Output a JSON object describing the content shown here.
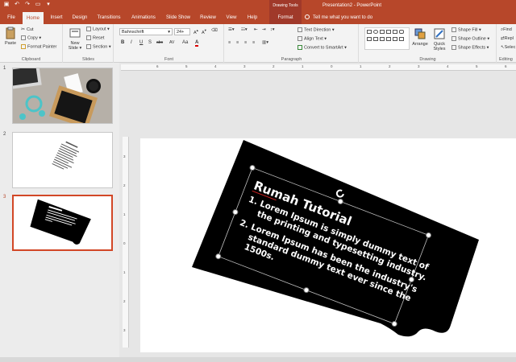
{
  "window": {
    "title": "Presentation2 - PowerPoint",
    "contextual_label": "Drawing Tools"
  },
  "tabs": [
    "File",
    "Home",
    "Insert",
    "Design",
    "Transitions",
    "Animations",
    "Slide Show",
    "Review",
    "View",
    "Help",
    "Format"
  ],
  "active_tab": "Home",
  "tell_me": "Tell me what you want to do",
  "ribbon": {
    "clipboard": {
      "label": "Clipboard",
      "paste": "Paste",
      "cut": "Cut",
      "copy": "Copy",
      "format_painter": "Format Painter"
    },
    "slides": {
      "label": "Slides",
      "new_slide": "New Slide",
      "layout": "Layout",
      "reset": "Reset",
      "section": "Section"
    },
    "font": {
      "label": "Font",
      "family": "Bahnschrift",
      "size": "24+",
      "bold": "B",
      "italic": "I",
      "underline": "U",
      "strike": "S",
      "shadow": "abc",
      "spacing": "AV",
      "case": "Aa",
      "color": "A"
    },
    "paragraph": {
      "label": "Paragraph",
      "text_direction": "Text Direction",
      "align_text": "Align Text",
      "convert": "Convert to SmartArt"
    },
    "drawing": {
      "label": "Drawing",
      "arrange": "Arrange",
      "quick_styles": "Quick Styles",
      "shape_fill": "Shape Fill",
      "shape_outline": "Shape Outline",
      "shape_effects": "Shape Effects"
    },
    "editing": {
      "label": "Editing",
      "find": "Find",
      "replace": "Repl",
      "select": "Selec"
    }
  },
  "ruler": {
    "h_ticks": [
      "6",
      "5",
      "4",
      "3",
      "2",
      "1",
      "0",
      "1",
      "2",
      "3",
      "4",
      "5",
      "6"
    ],
    "v_ticks": [
      "3",
      "2",
      "1",
      "0",
      "1",
      "2",
      "3"
    ]
  },
  "slides": [
    {
      "number": "1"
    },
    {
      "number": "2"
    },
    {
      "number": "3"
    }
  ],
  "slide_content": {
    "title": "Rumah Tutorial",
    "items": [
      "1.  Lorem Ipsum is simply dummy text of",
      "the printing and typesetting industry.",
      "2.  Lorem Ipsum has been the industry's",
      "standard dummy text ever since the",
      "1500s."
    ]
  },
  "colors": {
    "accent": "#b7472a",
    "slide_shape": "#000000",
    "selection_border": "#d24726"
  }
}
